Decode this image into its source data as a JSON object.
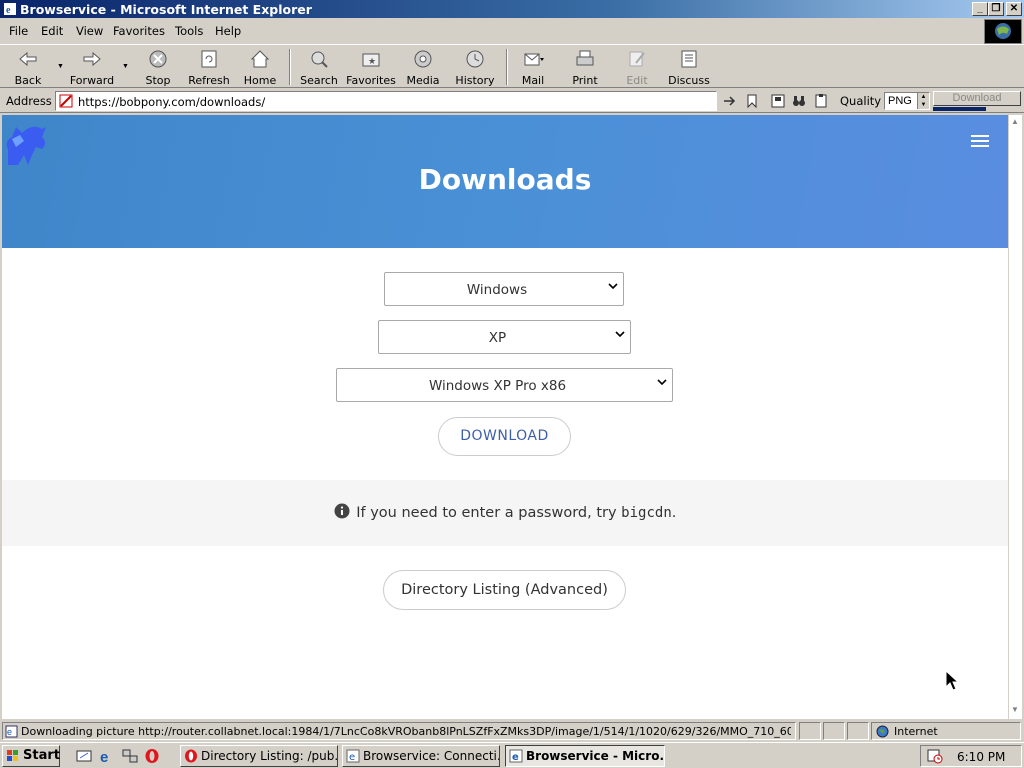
{
  "window": {
    "title": "Browservice - Microsoft Internet Explorer"
  },
  "menu": [
    "File",
    "Edit",
    "View",
    "Favorites",
    "Tools",
    "Help"
  ],
  "toolbar": {
    "back": "Back",
    "forward": "Forward",
    "stop": "Stop",
    "refresh": "Refresh",
    "home": "Home",
    "search": "Search",
    "favorites": "Favorites",
    "media": "Media",
    "history": "History",
    "mail": "Mail",
    "print": "Print",
    "edit": "Edit",
    "discuss": "Discuss"
  },
  "address": {
    "label": "Address",
    "url": "https://bobpony.com/downloads/",
    "quality_label": "Quality",
    "quality_value": "PNG",
    "download_label": "Download",
    "download_progress": 0.6
  },
  "page": {
    "hero_title": "Downloads",
    "os_select": "Windows",
    "version_select": "XP",
    "edition_select": "Windows XP Pro x86",
    "download_button": "DOWNLOAD",
    "notice_prefix": "If you need to enter a password, try",
    "notice_code": "bigcdn",
    "notice_suffix": ".",
    "directory_button": "Directory Listing (Advanced)"
  },
  "status": {
    "text": "Downloading picture http://router.collabnet.local:1984/1/7LncCo8kVRObanb8lPnLSZfFxZMks3DP/image/1/514/1/1020/629/326/MMO_710_60",
    "zone": "Internet"
  },
  "taskbar": {
    "start": "Start",
    "tasks": [
      "Directory Listing: /pub...",
      "Browservice: Connecti...",
      "Browservice - Micro..."
    ],
    "time": "6:10 PM"
  },
  "colors": {
    "hero": "#4a90d6",
    "title_bar": "#0a246a",
    "link": "#3f5fa8"
  }
}
